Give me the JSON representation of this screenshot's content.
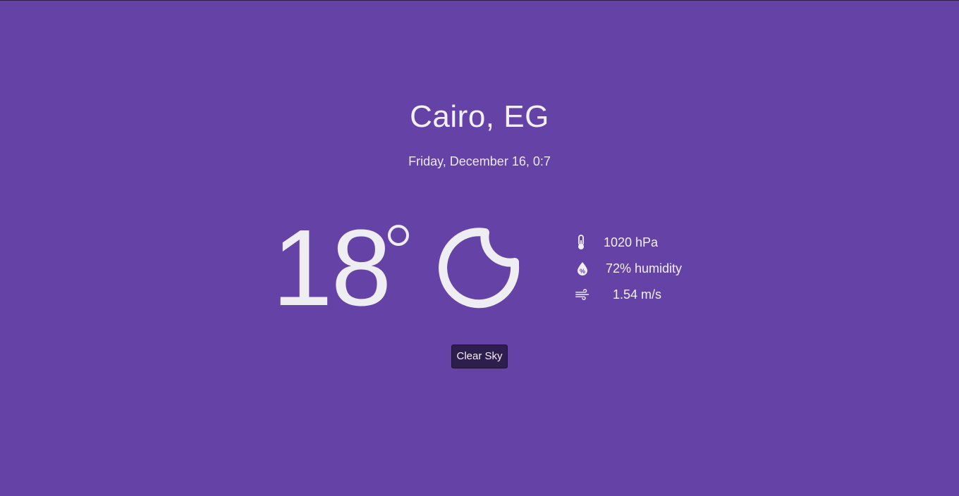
{
  "location": {
    "city_label": "Cairo, EG",
    "datetime": "Friday, December 16, 0:7"
  },
  "current": {
    "temperature": "18",
    "condition_icon": "moon-icon",
    "description": "Clear Sky"
  },
  "details": {
    "pressure": {
      "icon": "thermometer-icon",
      "text": "1020 hPa"
    },
    "humidity": {
      "icon": "humidity-drop-icon",
      "text": "72% humidity"
    },
    "wind": {
      "icon": "wind-icon",
      "text": "1.54 m/s"
    }
  },
  "colors": {
    "background": "#6542a6",
    "text": "#f2f0f7",
    "button_bg": "#2d1f4d"
  }
}
